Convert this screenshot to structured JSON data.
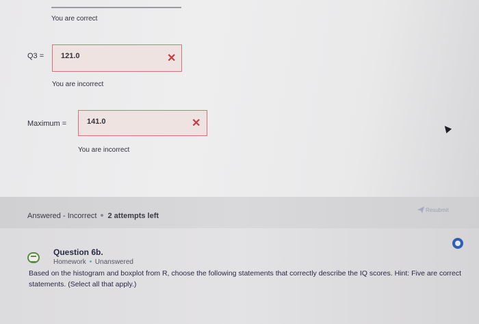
{
  "q3": {
    "prev_feedback": "You are correct",
    "label": "Q3 =",
    "value": "121.0",
    "mark": "✕",
    "feedback": "You are incorrect"
  },
  "maximum": {
    "label": "Maximum =",
    "value": "141.0",
    "mark": "✕",
    "feedback": "You are incorrect"
  },
  "status": {
    "state": "Answered - Incorrect",
    "attempts": "2 attempts left",
    "resubmit_label": "Resubmit",
    "resubmit_icon": "paper-plane-icon"
  },
  "question": {
    "title": "Question 6b.",
    "type": "Homework",
    "status": "Unanswered",
    "icon": "question-list-icon",
    "text": "Based on the histogram and boxplot from R, choose the following statements that correctly describe the IQ scores. Hint: Five are correct statements. (Select all that apply.)"
  },
  "colors": {
    "error_border": "#d7707a",
    "error_mark": "#c33c44",
    "accent": "#2f5fb0"
  }
}
